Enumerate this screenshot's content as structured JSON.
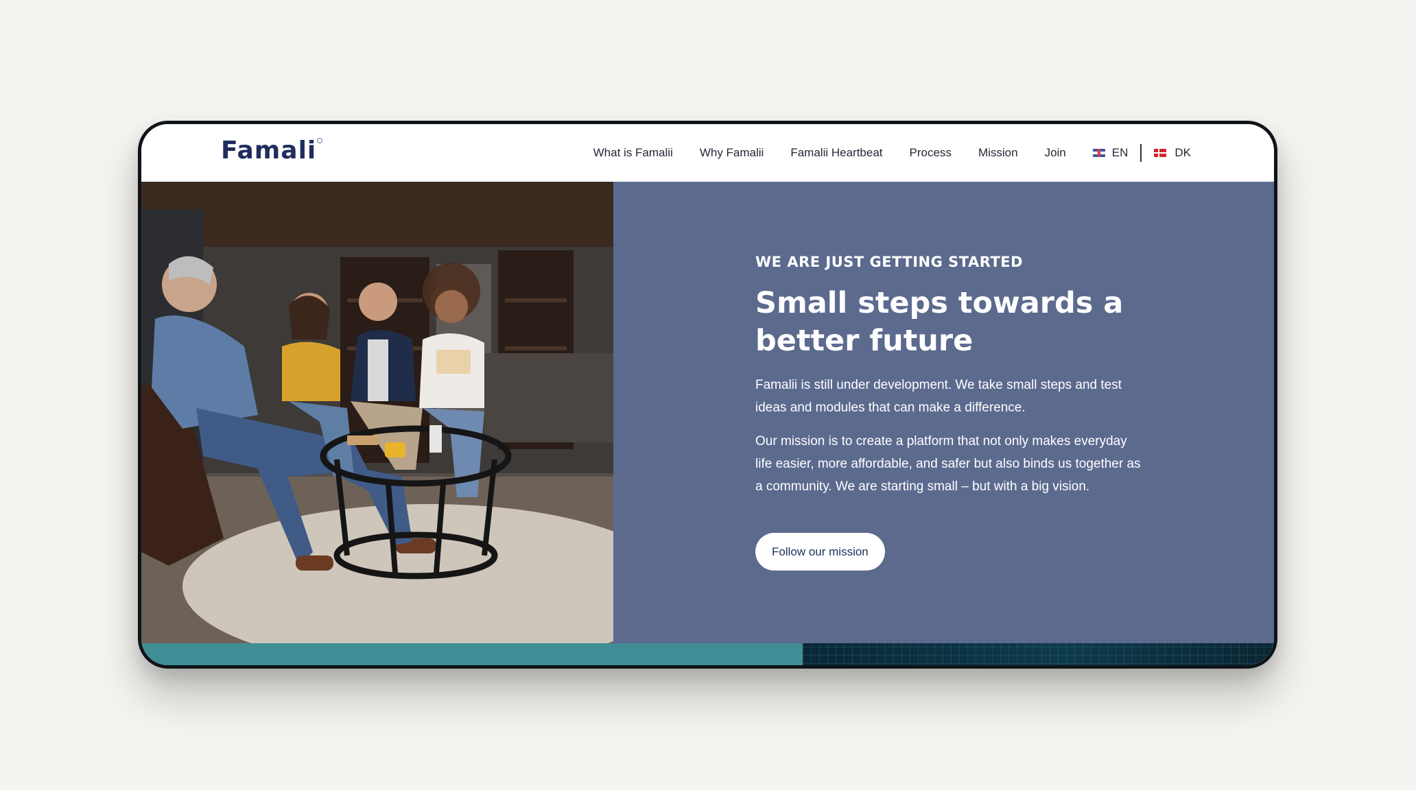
{
  "brand": {
    "logo_text": "Famali"
  },
  "nav": {
    "items": [
      {
        "label": "What is Famalii"
      },
      {
        "label": "Why Famalii"
      },
      {
        "label": "Famalii Heartbeat"
      },
      {
        "label": "Process"
      },
      {
        "label": "Mission"
      },
      {
        "label": "Join"
      }
    ],
    "lang_en": "EN",
    "lang_dk": "DK"
  },
  "hero": {
    "eyebrow": "WE ARE JUST GETTING STARTED",
    "headline": "Small steps towards a better future",
    "paragraph_1": "Famalii is still under development. We take small steps and test ideas and modules that can make a difference.",
    "paragraph_2": "Our mission is to create a platform that not only makes everyday life easier, more affordable, and safer but also binds us together as a community. We are starting small – but with a big vision.",
    "cta_label": "Follow our mission"
  },
  "colors": {
    "panel": "#5c6a8e",
    "brand_navy": "#1f2d5e",
    "band_teal": "#3f8d95",
    "band_dark": "#0e3a4c"
  }
}
